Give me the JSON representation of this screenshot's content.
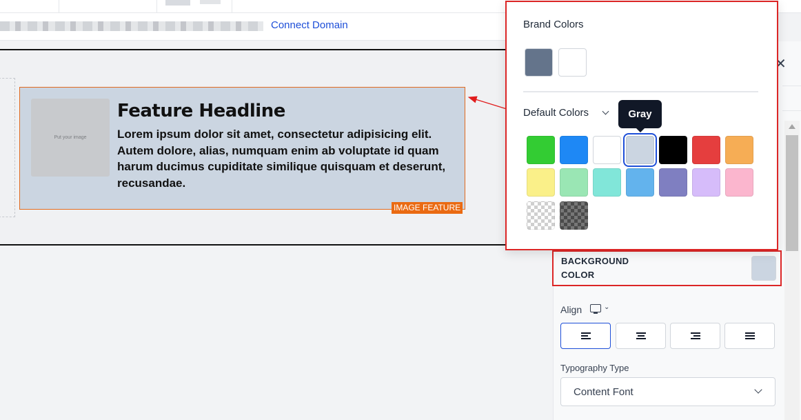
{
  "header": {
    "connect_domain": "Connect Domain"
  },
  "canvas": {
    "feature": {
      "image_placeholder": "Put your image",
      "headline": "Feature Headline",
      "body": "Lorem ipsum dolor sit amet, consectetur adipisicing elit. Autem dolore, alias, numquam enim ab voluptate id quam harum ducimus cupiditate similique quisquam et deserunt, recusandae.",
      "badge": "IMAGE FEATURE",
      "background": "#cbd5e1",
      "border_color": "#e26a1e"
    }
  },
  "color_picker": {
    "brand_title": "Brand Colors",
    "brand_colors": [
      "#64748b",
      "#ffffff"
    ],
    "default_title": "Default Colors",
    "tooltip": "Gray",
    "selected": "#cbd5e1",
    "default_colors": [
      [
        "#33cc33",
        "#1e88f5",
        "#ffffff",
        "#cbd5e1",
        "#000000",
        "#e53e3e",
        "#f6ad55"
      ],
      [
        "#faf089",
        "#9ae6b4",
        "#81e6d9",
        "#63b3ed",
        "#7f7fc1",
        "#d6bcfa",
        "#fbb6ce"
      ],
      [
        "transparent",
        "transparent-dark"
      ]
    ]
  },
  "panel": {
    "background_color_label": "BACKGROUND COLOR",
    "background_color_value": "#cbd5e1",
    "align_label": "Align",
    "align_options": [
      "left",
      "center",
      "right",
      "justify"
    ],
    "align_selected": "left",
    "typography_label": "Typography Type",
    "typography_value": "Content Font"
  }
}
